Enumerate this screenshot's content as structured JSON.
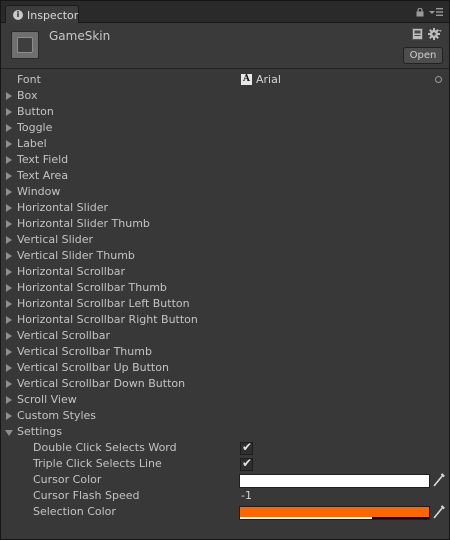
{
  "tab": {
    "title": "Inspector",
    "icon": "info-icon"
  },
  "header": {
    "asset_name": "GameSkin",
    "open_button": "Open",
    "icons": [
      "guiskin-asset-icon",
      "help-book-icon",
      "gear-icon",
      "lock-icon",
      "tab-menu-icon"
    ]
  },
  "font": {
    "label": "Font",
    "value": "Arial",
    "icon": "font-icon"
  },
  "styles": [
    {
      "label": "Box"
    },
    {
      "label": "Button"
    },
    {
      "label": "Toggle"
    },
    {
      "label": "Label"
    },
    {
      "label": "Text Field"
    },
    {
      "label": "Text Area"
    },
    {
      "label": "Window"
    },
    {
      "label": "Horizontal Slider"
    },
    {
      "label": "Horizontal Slider Thumb"
    },
    {
      "label": "Vertical Slider"
    },
    {
      "label": "Vertical Slider Thumb"
    },
    {
      "label": "Horizontal Scrollbar"
    },
    {
      "label": "Horizontal Scrollbar Thumb"
    },
    {
      "label": "Horizontal Scrollbar Left Button"
    },
    {
      "label": "Horizontal Scrollbar Right Button"
    },
    {
      "label": "Vertical Scrollbar"
    },
    {
      "label": "Vertical Scrollbar Thumb"
    },
    {
      "label": "Vertical Scrollbar Up Button"
    },
    {
      "label": "Vertical Scrollbar Down Button"
    },
    {
      "label": "Scroll View"
    },
    {
      "label": "Custom Styles"
    }
  ],
  "settings": {
    "label": "Settings",
    "expanded": true,
    "double_click": {
      "label": "Double Click Selects Word",
      "checked": true
    },
    "triple_click": {
      "label": "Triple Click Selects Line",
      "checked": true
    },
    "cursor_color": {
      "label": "Cursor Color",
      "color": "#ffffff",
      "alpha": 1.0
    },
    "cursor_flash_speed": {
      "label": "Cursor Flash Speed",
      "value": "-1"
    },
    "selection_color": {
      "label": "Selection Color",
      "color": "#ff6600",
      "alpha": 0.7
    }
  },
  "colors": {
    "panel_background": "#383838",
    "text": "#c4c4c4",
    "selection_orange": "#ff6600"
  }
}
